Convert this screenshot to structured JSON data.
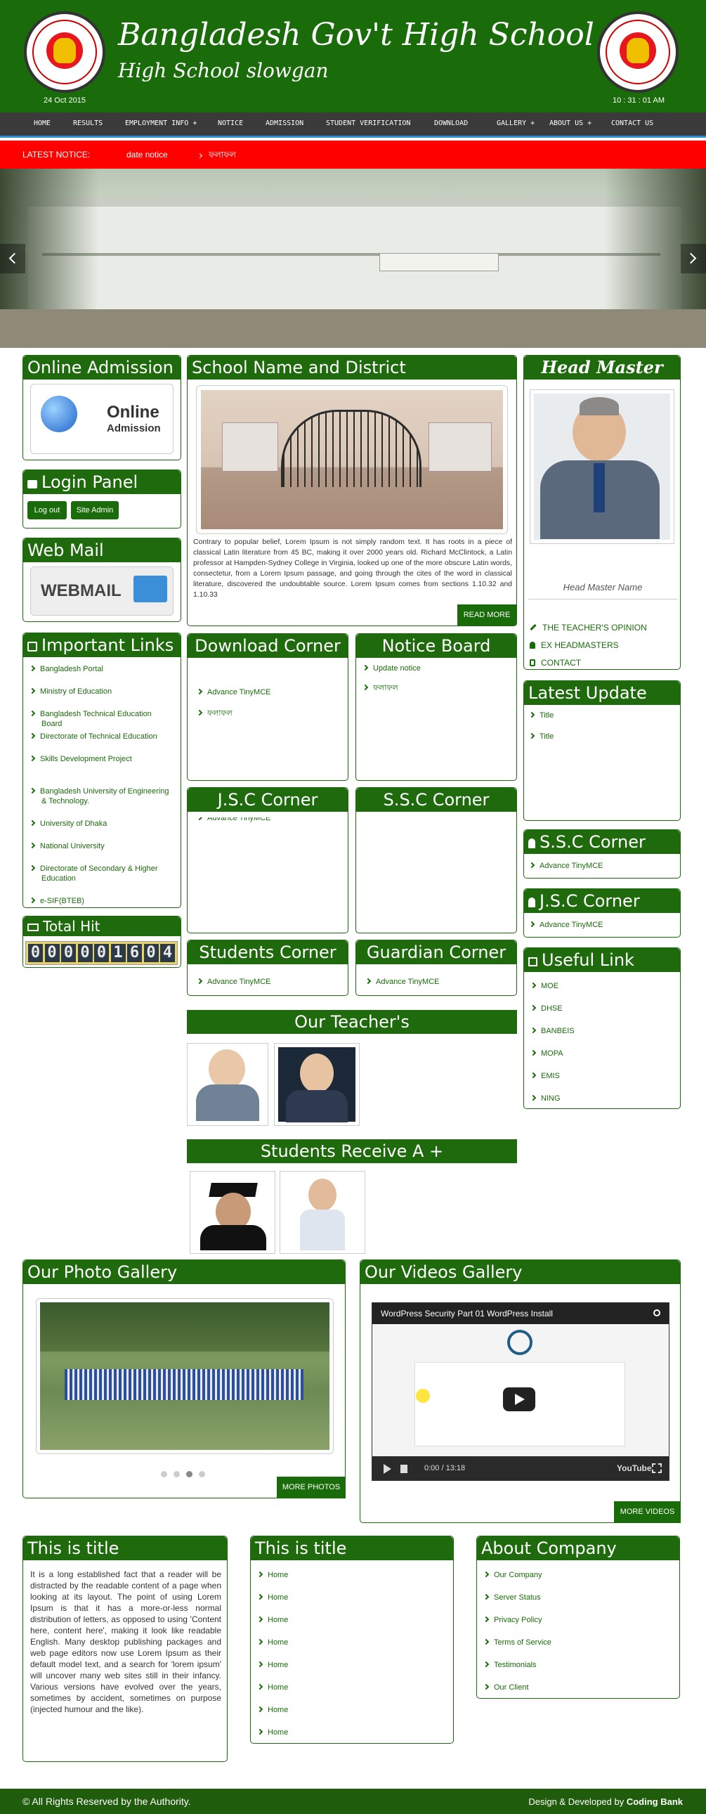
{
  "header": {
    "title": "Bangladesh Gov't High School",
    "slogan": "High School slowgan",
    "date": "24 Oct 2015",
    "time": "10 : 31 : 01 AM"
  },
  "nav": [
    "HOME",
    "RESULTS",
    "EMPLOYMENT INFO +",
    "NOTICE",
    "ADMISSION",
    "STUDENT VERIFICATION",
    "DOWNLOAD",
    "GALLERY +",
    "ABOUT US +",
    "CONTACT US"
  ],
  "notice": {
    "label": "LATEST NOTICE:",
    "items": [
      "date notice",
      "ফলাফল"
    ]
  },
  "online_admission": {
    "title": "Online Admission",
    "image_text_1": "Online",
    "image_text_2": "Admission"
  },
  "login": {
    "title": "Login Panel",
    "logout": "Log out",
    "site_admin": "Site Admin"
  },
  "webmail": {
    "title": "Web Mail",
    "image_text": "WEBMAIL"
  },
  "important_links": {
    "title": "Important Links",
    "items": [
      "Bangladesh Portal",
      "Ministry of Education",
      "Bangladesh Technical Education Board",
      "Directorate of Technical Education",
      "Skills Development Project",
      "Bangladesh University of Engineering & Technology.",
      "University of Dhaka",
      "National University",
      "Directorate of Secondary & Higher Education",
      "e-SIF(BTEB)"
    ]
  },
  "total_hit": {
    "title": "Total Hit",
    "digits": [
      "0",
      "0",
      "0",
      "0",
      "0",
      "1",
      "6",
      "0",
      "4"
    ]
  },
  "school": {
    "title": "School Name and District",
    "text": "Contrary to popular belief, Lorem Ipsum is not simply random text. It has roots in a piece of classical Latin literature from 45 BC, making it over 2000 years old. Richard McClintock, a Latin professor at Hampden-Sydney College in Virginia, looked up one of the more obscure Latin words, consectetur, from a Lorem Ipsum passage, and going through the cites of the word in classical literature, discovered the undoubtable source. Lorem Ipsum comes from sections 1.10.32 and 1.10.33",
    "read_more": "READ MORE"
  },
  "head_master": {
    "title": "Head Master",
    "caption": "Head Master Name",
    "links": [
      "THE TEACHER'S OPINION",
      "EX HEADMASTERS",
      "CONTACT"
    ]
  },
  "download_corner": {
    "title": "Download Corner",
    "items": [
      "Advance TinyMCE",
      "ফলাফল"
    ]
  },
  "notice_board": {
    "title": "Notice Board",
    "items": [
      "Update notice",
      "ফলাফল"
    ]
  },
  "latest_update": {
    "title": "Latest Update",
    "items": [
      "Title",
      "Title"
    ]
  },
  "jsc_corner": {
    "title": "J.S.C Corner",
    "items": [
      "Advance TinyMCE"
    ]
  },
  "ssc_corner": {
    "title": "S.S.C Corner"
  },
  "ssc_side": {
    "title": "S.S.C Corner",
    "items": [
      "Advance TinyMCE"
    ]
  },
  "jsc_side": {
    "title": "J.S.C Corner",
    "items": [
      "Advance TinyMCE"
    ]
  },
  "students_corner": {
    "title": "Students Corner",
    "items": [
      "Advance TinyMCE"
    ]
  },
  "guardian_corner": {
    "title": "Guardian Corner",
    "items": [
      "Advance TinyMCE"
    ]
  },
  "useful_link": {
    "title": "Useful Link",
    "items": [
      "MOE",
      "DHSE",
      "BANBEIS",
      "MOPA",
      "EMIS",
      "NING"
    ]
  },
  "teachers": {
    "title": "Our Teacher's"
  },
  "students_a": {
    "title": "Students Receive A +"
  },
  "photo_gallery": {
    "title": "Our Photo Gallery",
    "button": "MORE PHOTOS"
  },
  "video_gallery": {
    "title": "Our Videos Gallery",
    "video_title": "WordPress Security Part 01 WordPress Install",
    "time": "0:00 / 13:18",
    "button": "MORE VIDEOS",
    "youtube": "YouTube"
  },
  "footer_col1": {
    "title": "This is title",
    "text": "It is a long established fact that a reader will be distracted by the readable content of a page when looking at its layout. The point of using Lorem Ipsum is that it has a more-or-less normal distribution of letters, as opposed to using 'Content here, content here', making it look like readable English. Many desktop publishing packages and web page editors now use Lorem Ipsum as their default model text, and a search for 'lorem ipsum' will uncover many web sites still in their infancy. Various versions have evolved over the years, sometimes by accident, sometimes on purpose (injected humour and the like)."
  },
  "footer_col2": {
    "title": "This is title",
    "items": [
      "Home",
      "Home",
      "Home",
      "Home",
      "Home",
      "Home",
      "Home",
      "Home"
    ]
  },
  "footer_col3": {
    "title": "About Company",
    "items": [
      "Our Company",
      "Server Status",
      "Privacy Policy",
      "Terms of Service",
      "Testimonials",
      "Our Client"
    ]
  },
  "bottom": {
    "copyright": "© All Rights Reserved by the Authority.",
    "design": "Design & Developed by ",
    "designer": "Coding Bank"
  },
  "colors": {
    "green": "#1a6b0a",
    "notice_red": "#ff0000",
    "nav_dark": "#3a3a3a"
  }
}
